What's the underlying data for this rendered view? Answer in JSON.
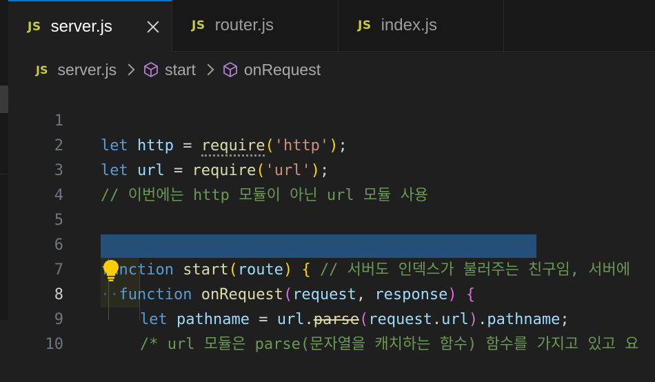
{
  "tabs": [
    {
      "icon": "JS",
      "label": "server.js",
      "active": true,
      "closable": true
    },
    {
      "icon": "JS",
      "label": "router.js",
      "active": false,
      "closable": false
    },
    {
      "icon": "JS",
      "label": "index.js",
      "active": false,
      "closable": false
    }
  ],
  "breadcrumb": {
    "file_icon": "JS",
    "file": "server.js",
    "symbol1": "start",
    "symbol2": "onRequest"
  },
  "lines": [
    {
      "n": "1"
    },
    {
      "n": "2"
    },
    {
      "n": "3"
    },
    {
      "n": "4"
    },
    {
      "n": "5"
    },
    {
      "n": "6"
    },
    {
      "n": "7"
    },
    {
      "n": "8"
    },
    {
      "n": "9"
    },
    {
      "n": "10"
    }
  ],
  "code": {
    "l1": {
      "kw": "let",
      "var": "http",
      "eq": "=",
      "fn": "require",
      "open": "(",
      "str": "'http'",
      "close": ")",
      "semi": ";"
    },
    "l2": {
      "kw": "let",
      "var": "url",
      "eq": "=",
      "fn": "require",
      "open": "(",
      "str": "'url'",
      "close": ")",
      "semi": ";"
    },
    "l3": {
      "comment": "// 이번에는 http 모듈이 아닌 url 모듈 사용"
    },
    "l6": {
      "kw": "function",
      "fn": "start",
      "open": "(",
      "param": "route",
      "close": ")",
      "brace": "{",
      "comment": "// 서버도 인덱스가 불러주는 친구임, 서버에"
    },
    "l7": {
      "ws": "··",
      "kw": "function",
      "fn": "onRequest",
      "open": "(",
      "p1": "request",
      "comma": ",",
      "p2": "response",
      "close": ")",
      "brace": "{"
    },
    "l8": {
      "kw": "let",
      "var": "pathname",
      "eq": "=",
      "obj": "url",
      "dot": ".",
      "fn": "parse",
      "open": "(",
      "arg": "request",
      "dot2": ".",
      "prop": "url",
      "close": ")",
      "dot3": ".",
      "prop2": "pathname",
      "semi": ";"
    },
    "l9": {
      "comment": "/* url 모듈은 parse(문자열을 캐치하는 함수) 함수를 가지고 있고 요"
    }
  },
  "colors": {
    "accent": "#0078d4",
    "keyword": "#569cd6",
    "function": "#dcdcaa",
    "variable": "#9cdcfe",
    "string": "#ce9178",
    "comment": "#6a9955",
    "selection": "#264f78",
    "js_icon": "#cbcb41"
  },
  "icons": {
    "tab_close": "close-icon",
    "breadcrumb_symbol": "symbol-method-icon",
    "lightbulb": "lightbulb-icon"
  }
}
